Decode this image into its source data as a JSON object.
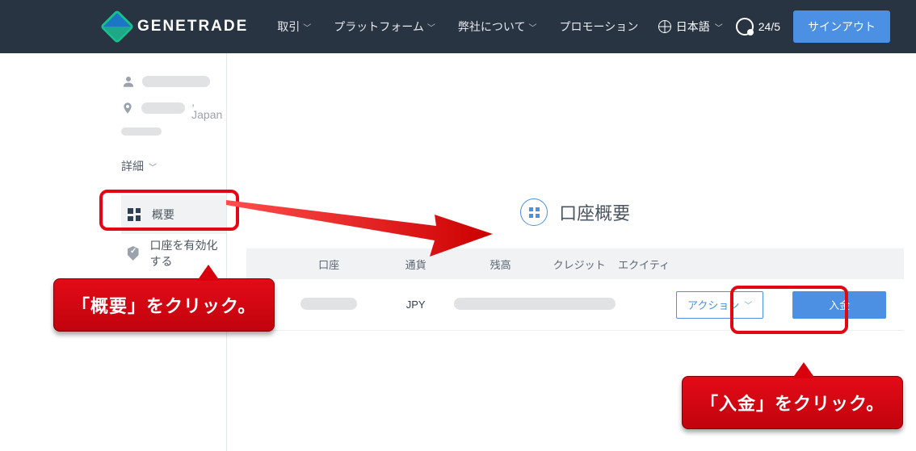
{
  "header": {
    "brand": "GENETRADE",
    "nav": {
      "trade": "取引",
      "platform": "プラットフォーム",
      "about": "弊社について",
      "promo": "プロモーション"
    },
    "language": "日本語",
    "support": "24/5",
    "signout": "サインアウト"
  },
  "sidebar": {
    "location_suffix": ", Japan",
    "details": "詳細",
    "items": {
      "overview": "概要",
      "activate": "口座を有効化する"
    }
  },
  "main": {
    "title": "口座概要",
    "columns": {
      "account": "口座",
      "currency": "通貨",
      "balance": "残高",
      "credit": "クレジット",
      "equity": "エクイティ"
    },
    "row": {
      "currency": "JPY",
      "action": "アクション",
      "deposit": "入金"
    }
  },
  "annotations": {
    "overview_click": "「概要」をクリック。",
    "deposit_click": "「入金」をクリック。"
  }
}
